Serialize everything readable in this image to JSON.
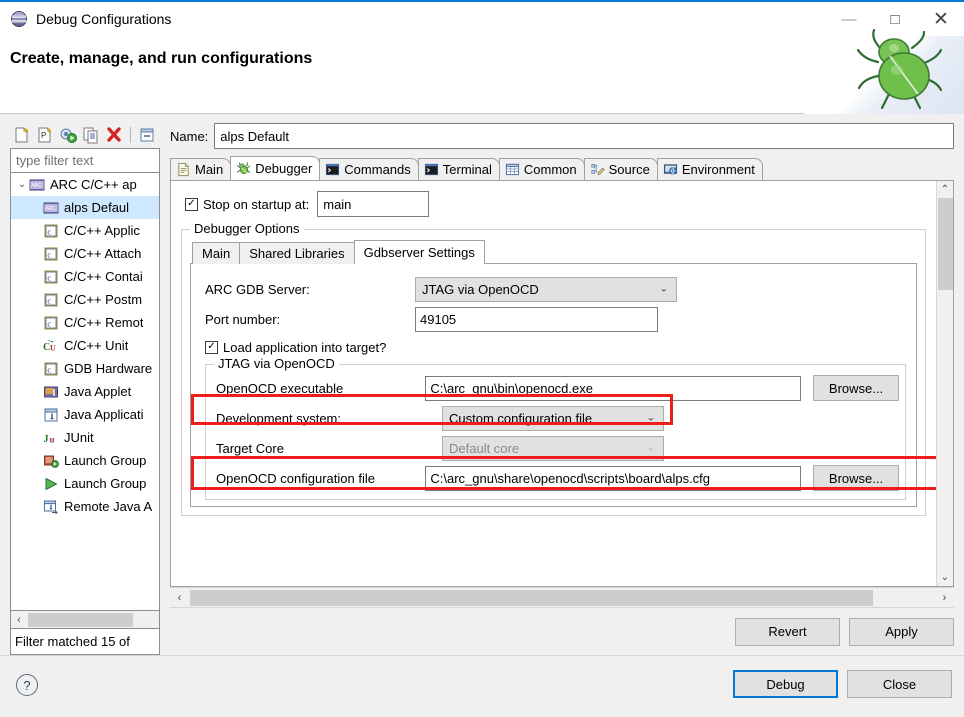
{
  "window": {
    "title": "Debug Configurations",
    "title_icon": "debug-configurations-icon",
    "minimize": "—",
    "maximize": "□",
    "close": "✕"
  },
  "header": {
    "heading": "Create, manage, and run configurations",
    "decoration_icon": "green-bug-icon"
  },
  "tree_toolbar": {
    "buttons": [
      {
        "name": "new-configuration-icon",
        "tip": "New launch configuration"
      },
      {
        "name": "new-prototype-icon",
        "tip": "New prototype"
      },
      {
        "name": "export-icon",
        "tip": "Export"
      },
      {
        "name": "duplicate-icon",
        "tip": "Duplicate"
      },
      {
        "name": "delete-icon",
        "tip": "Delete"
      },
      {
        "name": "collapse-all-icon",
        "tip": "Collapse All"
      }
    ]
  },
  "filter": {
    "placeholder": "type filter text",
    "value": "",
    "status": "Filter matched 15 of"
  },
  "tree": {
    "items": [
      {
        "label": "ARC C/C++ ap",
        "icon": "arc-icon",
        "level": 0,
        "expanded": true,
        "selected": false,
        "twisty": "⌄"
      },
      {
        "label": "alps Defaul",
        "icon": "arc-icon",
        "level": 1,
        "expanded": false,
        "selected": true,
        "twisty": ""
      },
      {
        "label": "C/C++ Applic",
        "icon": "c-cpp-icon",
        "level": 1,
        "expanded": false,
        "selected": false,
        "twisty": ""
      },
      {
        "label": "C/C++ Attach",
        "icon": "c-cpp-icon",
        "level": 1,
        "expanded": false,
        "selected": false,
        "twisty": ""
      },
      {
        "label": "C/C++ Contai",
        "icon": "c-cpp-icon",
        "level": 1,
        "expanded": false,
        "selected": false,
        "twisty": ""
      },
      {
        "label": "C/C++ Postm",
        "icon": "c-cpp-icon",
        "level": 1,
        "expanded": false,
        "selected": false,
        "twisty": ""
      },
      {
        "label": "C/C++ Remot",
        "icon": "c-cpp-icon",
        "level": 1,
        "expanded": false,
        "selected": false,
        "twisty": ""
      },
      {
        "label": "C/C++ Unit",
        "icon": "cunit-icon",
        "level": 1,
        "expanded": false,
        "selected": false,
        "twisty": ""
      },
      {
        "label": "GDB Hardware",
        "icon": "c-cpp-icon",
        "level": 1,
        "expanded": false,
        "selected": false,
        "twisty": ""
      },
      {
        "label": "Java Applet",
        "icon": "java-applet-icon",
        "level": 1,
        "expanded": false,
        "selected": false,
        "twisty": ""
      },
      {
        "label": "Java Applicati",
        "icon": "java-application-icon",
        "level": 1,
        "expanded": false,
        "selected": false,
        "twisty": ""
      },
      {
        "label": "JUnit",
        "icon": "junit-icon",
        "level": 1,
        "expanded": false,
        "selected": false,
        "twisty": ""
      },
      {
        "label": "Launch Group",
        "icon": "launch-group-icon",
        "level": 1,
        "expanded": false,
        "selected": false,
        "twisty": ""
      },
      {
        "label": "Launch Group",
        "icon": "launch-group-deprecated-icon",
        "level": 1,
        "expanded": false,
        "selected": false,
        "twisty": ""
      },
      {
        "label": "Remote Java A",
        "icon": "remote-java-icon",
        "level": 1,
        "expanded": false,
        "selected": false,
        "twisty": ""
      }
    ]
  },
  "config": {
    "name_label": "Name:",
    "name_value": "alps Default"
  },
  "tabs": [
    {
      "label": "Main",
      "icon": "document-icon",
      "active": false
    },
    {
      "label": "Debugger",
      "icon": "bug-icon",
      "active": true
    },
    {
      "label": "Commands",
      "icon": "console-icon",
      "active": false
    },
    {
      "label": "Terminal",
      "icon": "console-icon",
      "active": false
    },
    {
      "label": "Common",
      "icon": "table-icon",
      "active": false
    },
    {
      "label": "Source",
      "icon": "source-edit-icon",
      "active": false
    },
    {
      "label": "Environment",
      "icon": "environment-icon",
      "active": false
    }
  ],
  "debugger": {
    "stop_on_startup": {
      "label": "Stop on startup at:",
      "checked": true,
      "check_glyph": "✓",
      "value": "main"
    },
    "options_group_title": "Debugger Options",
    "inner_tabs": [
      {
        "label": "Main",
        "active": false
      },
      {
        "label": "Shared Libraries",
        "active": false
      },
      {
        "label": "Gdbserver Settings",
        "active": true
      }
    ],
    "fields": {
      "gdb_server_label": "ARC GDB Server:",
      "gdb_server_value": "JTAG via OpenOCD",
      "port_label": "Port number:",
      "port_value": "49105",
      "load_app_label": "Load application into target?",
      "load_app_checked": true,
      "jtag_group_title": "JTAG via OpenOCD",
      "openocd_exe_label": "OpenOCD executable",
      "openocd_exe_value": "C:\\arc_gnu\\bin\\openocd.exe",
      "dev_system_label": "Development system:",
      "dev_system_value": "Custom configuration file",
      "target_core_label": "Target Core",
      "target_core_value": "Default core",
      "target_core_disabled": true,
      "config_file_label": "OpenOCD configuration file",
      "config_file_value": "C:\\arc_gnu\\share\\openocd\\scripts\\board\\alps.cfg",
      "browse_label": "Browse...",
      "dropdown_caret": "⌄"
    }
  },
  "action_bar": {
    "revert": "Revert",
    "apply": "Apply"
  },
  "footer": {
    "help": "?",
    "debug": "Debug",
    "close": "Close"
  },
  "scrollbars": {
    "up_arrow": "⌃",
    "down_arrow": "⌄",
    "left_arrow": "‹",
    "right_arrow": "›"
  },
  "colors": {
    "accent": "#0078d7",
    "highlight_red": "#ee1c1c",
    "selection": "#cde8ff"
  }
}
